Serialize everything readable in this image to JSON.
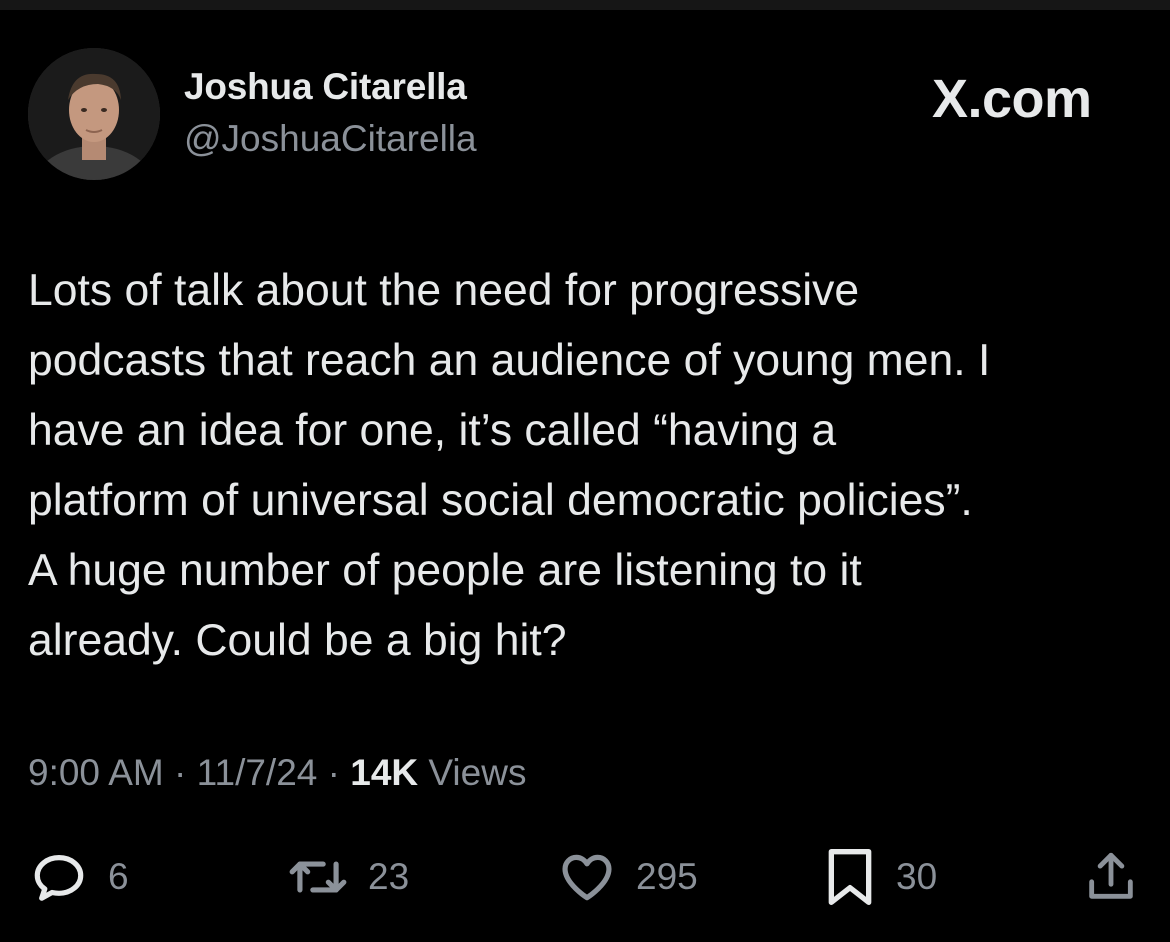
{
  "author": {
    "display_name": "Joshua Citarella",
    "handle": "@JoshuaCitarella",
    "avatar_icon": "profile-photo"
  },
  "brand": {
    "watermark": "X.com"
  },
  "tweet": {
    "text": "Lots of talk about the need for progressive\npodcasts that reach an audience of young men. I\nhave an idea for one, it’s called “having a\nplatform of universal social democratic policies”.\nA huge number of people are listening to it\nalready. Could be a big hit?",
    "time": "9:00 AM",
    "date": "11/7/24",
    "separator": "·",
    "views_count": "14K",
    "views_label": "Views"
  },
  "actions": {
    "replies": "6",
    "reposts": "23",
    "likes": "295",
    "bookmarks": "30",
    "icons": [
      "reply-icon",
      "repost-icon",
      "like-icon",
      "bookmark-icon",
      "share-icon"
    ]
  },
  "colors": {
    "background": "#000000",
    "text_primary": "#e7e9ea",
    "text_secondary": "#8b9199"
  }
}
